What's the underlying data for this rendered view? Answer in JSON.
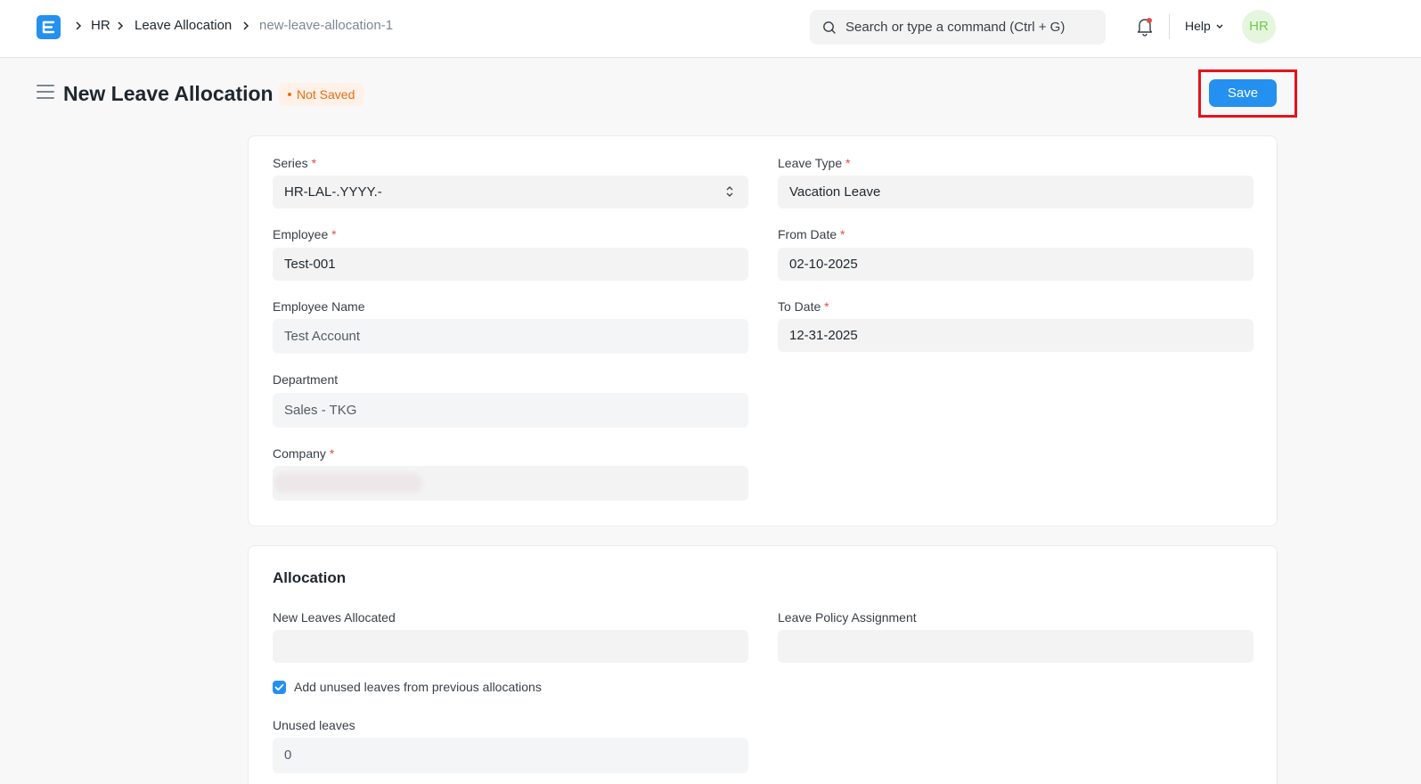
{
  "navbar": {
    "breadcrumbs": [
      "HR",
      "Leave Allocation",
      "new-leave-allocation-1"
    ],
    "search_placeholder": "Search or type a command (Ctrl + G)",
    "help_label": "Help",
    "avatar_initials": "HR"
  },
  "page": {
    "title": "New Leave Allocation",
    "status": "Not Saved",
    "save_label": "Save"
  },
  "form": {
    "series": {
      "label": "Series",
      "value": "HR-LAL-.YYYY.-"
    },
    "leave_type": {
      "label": "Leave Type",
      "value": "Vacation Leave"
    },
    "employee": {
      "label": "Employee",
      "value": "Test-001"
    },
    "from_date": {
      "label": "From Date",
      "value": "02-10-2025"
    },
    "employee_name": {
      "label": "Employee Name",
      "value": "Test Account"
    },
    "to_date": {
      "label": "To Date",
      "value": "12-31-2025"
    },
    "department": {
      "label": "Department",
      "value": "Sales - TKG"
    },
    "company": {
      "label": "Company",
      "value": ""
    },
    "required_mark": "*"
  },
  "allocation": {
    "title": "Allocation",
    "new_leaves_allocated": {
      "label": "New Leaves Allocated",
      "value": ""
    },
    "leave_policy_assignment": {
      "label": "Leave Policy Assignment",
      "value": ""
    },
    "carry_forward": {
      "label": "Add unused leaves from previous allocations",
      "checked": true
    },
    "unused_leaves": {
      "label": "Unused leaves",
      "value": "0"
    }
  },
  "colors": {
    "primary": "#2490ef",
    "status_orange": "#e86c13",
    "highlight_red": "#e3131b"
  }
}
